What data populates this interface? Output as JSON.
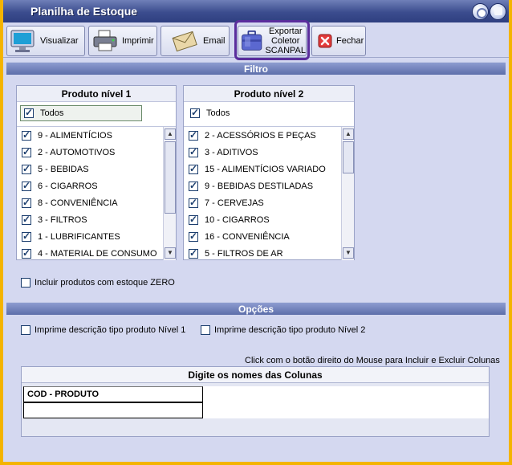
{
  "window": {
    "title": "Planilha de Estoque"
  },
  "toolbar": {
    "visualizar": "Visualizar",
    "imprimir": "Imprimir",
    "email": "Email",
    "exportar_l1": "Exportar",
    "exportar_l2": "Coletor",
    "exportar_l3": "SCANPAL",
    "fechar": "Fechar"
  },
  "filtro": {
    "title": "Filtro",
    "nivel1": {
      "header": "Produto nível 1",
      "todos": "Todos",
      "items": [
        "9 - ALIMENTÍCIOS",
        "2 - AUTOMOTIVOS",
        "5 - BEBIDAS",
        "6 - CIGARROS",
        "8 - CONVENIÊNCIA",
        "3 - FILTROS",
        "1 - LUBRIFICANTES",
        "4 - MATERIAL DE CONSUMO"
      ]
    },
    "nivel2": {
      "header": "Produto nível 2",
      "todos": "Todos",
      "items": [
        "2 - ACESSÓRIOS E PEÇAS",
        "3 - ADITIVOS",
        "15 - ALIMENTÍCIOS VARIADO",
        "9 - BEBIDAS DESTILADAS",
        "7 - CERVEJAS",
        "10 - CIGARROS",
        "16 - CONVENIÊNCIA",
        "5 - FILTROS DE AR"
      ]
    },
    "estoque_zero": "Incluir produtos com estoque ZERO"
  },
  "opcoes": {
    "title": "Opções",
    "desc_nivel1": "Imprime descrição tipo produto Nível 1",
    "desc_nivel2": "Imprime descrição tipo produto Nível 2",
    "hint": "Click com o botão direito do Mouse para Incluir e Excluir Colunas",
    "grid_header": "Digite os nomes das Colunas",
    "column1": "COD - PRODUTO"
  },
  "colors": {
    "accent": "#3b4c8e",
    "highlight": "#5a2d9c",
    "frame": "#f4b400"
  }
}
